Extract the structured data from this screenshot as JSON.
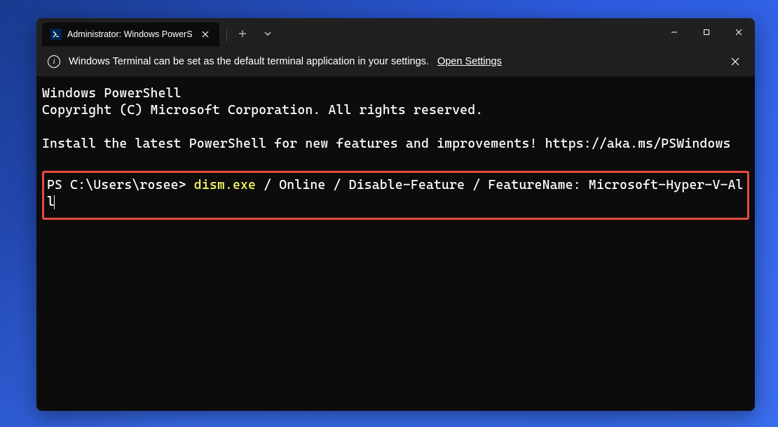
{
  "titlebar": {
    "tab_title": "Administrator: Windows PowerS",
    "new_tab_label": "+",
    "dropdown_label": "⌄"
  },
  "infobar": {
    "message": "Windows Terminal can be set as the default terminal application in your settings.",
    "link_label": "Open Settings"
  },
  "terminal": {
    "line1": "Windows PowerShell",
    "line2": "Copyright (C) Microsoft Corporation. All rights reserved.",
    "line3": "Install the latest PowerShell for new features and improvements! https://aka.ms/PSWindows",
    "prompt": "PS C:\\Users\\rosee> ",
    "command": "dism.exe",
    "args": " / Online / Disable-Feature / FeatureName: Microsoft-Hyper-V-All"
  }
}
